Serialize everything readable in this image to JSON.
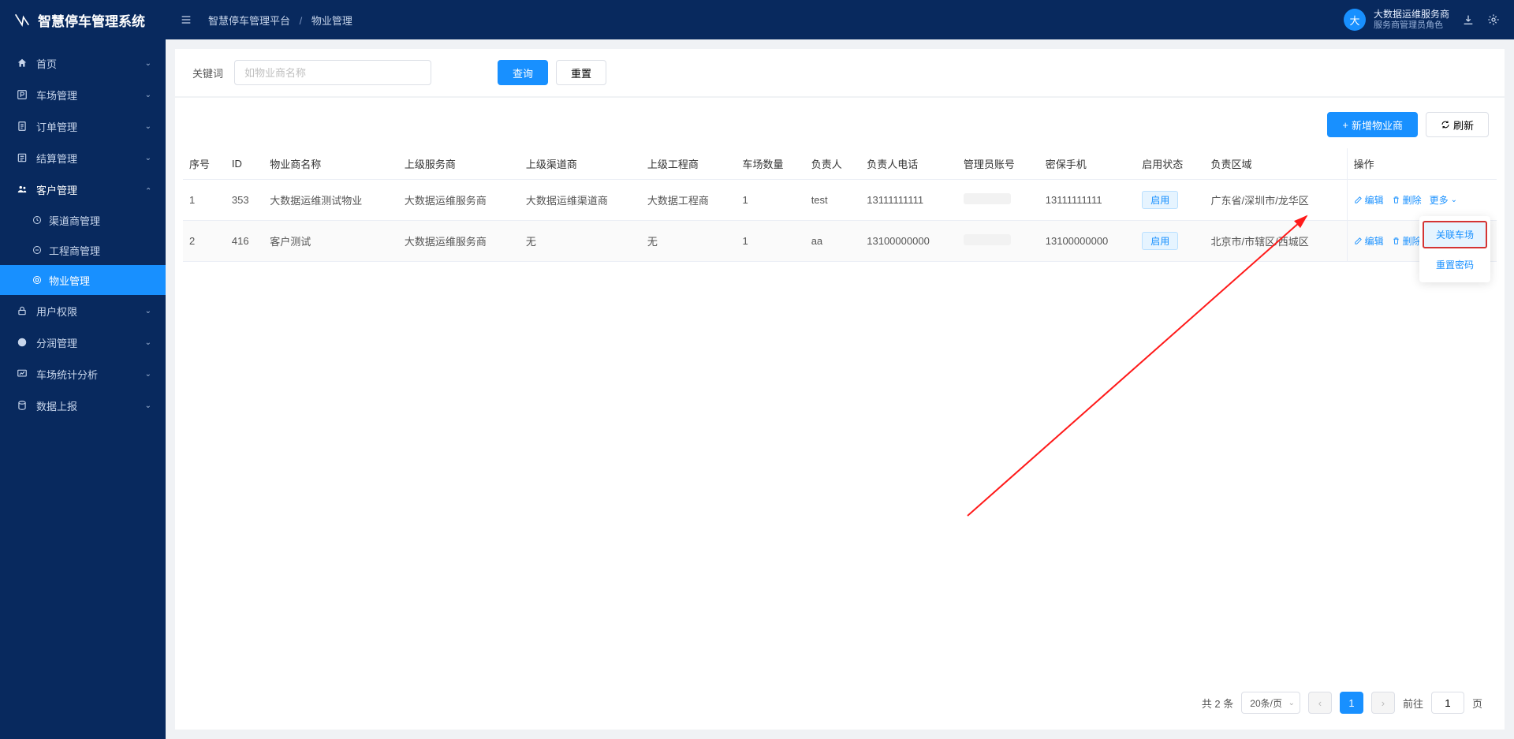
{
  "app_title": "智慧停车管理系统",
  "breadcrumb": {
    "root": "智慧停车管理平台",
    "current": "物业管理"
  },
  "user": {
    "avatar_text": "大",
    "name": "大数据运维服务商",
    "role": "服务商管理员角色"
  },
  "sidebar": {
    "items": [
      {
        "label": "首页"
      },
      {
        "label": "车场管理"
      },
      {
        "label": "订单管理"
      },
      {
        "label": "结算管理"
      },
      {
        "label": "客户管理",
        "expanded": true,
        "children": [
          {
            "label": "渠道商管理"
          },
          {
            "label": "工程商管理"
          },
          {
            "label": "物业管理",
            "active": true
          }
        ]
      },
      {
        "label": "用户权限"
      },
      {
        "label": "分润管理"
      },
      {
        "label": "车场统计分析"
      },
      {
        "label": "数据上报"
      }
    ]
  },
  "filter": {
    "label": "关键词",
    "placeholder": "如物业商名称",
    "search_btn": "查询",
    "reset_btn": "重置"
  },
  "toolbar": {
    "add_btn": "新增物业商",
    "refresh_btn": "刷新"
  },
  "table": {
    "headers": [
      "序号",
      "ID",
      "物业商名称",
      "上级服务商",
      "上级渠道商",
      "上级工程商",
      "车场数量",
      "负责人",
      "负责人电话",
      "管理员账号",
      "密保手机",
      "启用状态",
      "负责区域",
      "操作"
    ],
    "rows": [
      {
        "seq": "1",
        "id": "353",
        "name": "大数据运维测试物业",
        "svc": "大数据运维服务商",
        "chan": "大数据运维渠道商",
        "eng": "大数据工程商",
        "count": "1",
        "person": "test",
        "phone": "13111111111",
        "account": "",
        "secure": "13111111111",
        "status": "启用",
        "region": "广东省/深圳市/龙华区"
      },
      {
        "seq": "2",
        "id": "416",
        "name": "客户测试",
        "svc": "大数据运维服务商",
        "chan": "无",
        "eng": "无",
        "count": "1",
        "person": "aa",
        "phone": "13100000000",
        "account": "",
        "secure": "13100000000",
        "status": "启用",
        "region": "北京市/市辖区/西城区"
      }
    ],
    "ops": {
      "edit": "编辑",
      "delete": "删除",
      "more": "更多"
    }
  },
  "dropdown": {
    "item1": "关联车场",
    "item2": "重置密码"
  },
  "pagination": {
    "total_text": "共 2 条",
    "page_size": "20条/页",
    "current": "1",
    "jump_prefix": "前往",
    "jump_val": "1",
    "jump_suffix": "页"
  }
}
